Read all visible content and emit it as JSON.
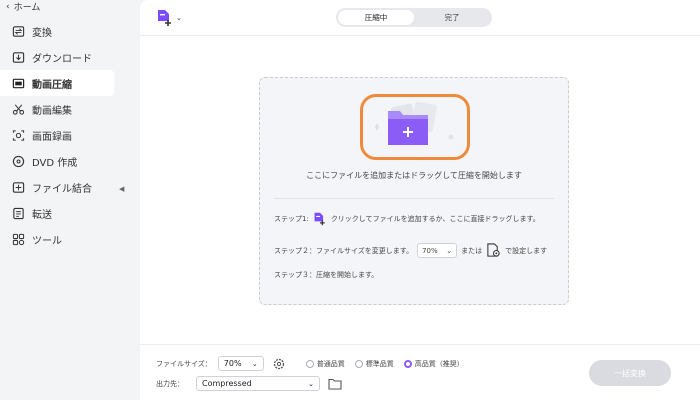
{
  "sidebar": {
    "back_label": "ホーム",
    "items": [
      {
        "label": "変換",
        "icon": "convert-icon"
      },
      {
        "label": "ダウンロード",
        "icon": "download-icon"
      },
      {
        "label": "動画圧縮",
        "icon": "compress-icon",
        "active": true
      },
      {
        "label": "動画編集",
        "icon": "scissors-icon"
      },
      {
        "label": "画面録画",
        "icon": "screen-record-icon"
      },
      {
        "label": "DVD 作成",
        "icon": "dvd-icon"
      },
      {
        "label": "ファイル結合",
        "icon": "merge-icon"
      },
      {
        "label": "転送",
        "icon": "transfer-icon"
      },
      {
        "label": "ツール",
        "icon": "tools-icon"
      }
    ]
  },
  "tabs": [
    {
      "label": "圧縮中",
      "active": true
    },
    {
      "label": "完了",
      "active": false
    }
  ],
  "dropzone": {
    "hint": "ここにファイルを追加またはドラッグして圧縮を開始します",
    "step1_prefix": "ステップ1:",
    "step1_text": "クリックしてファイルを追加するか、ここに直接ドラッグします。",
    "step2_prefix": "ステップ２：ファイルサイズを変更します。",
    "step2_value": "70%",
    "step2_or": "または",
    "step2_suffix": "で設定します",
    "step3": "ステップ３：圧縮を開始します。"
  },
  "bottom": {
    "filesize_label": "ファイルサイズ：",
    "filesize_value": "70%",
    "quality_options": [
      {
        "label": "普通品質",
        "selected": false
      },
      {
        "label": "標準品質",
        "selected": false
      },
      {
        "label": "高品質（推奨）",
        "selected": true
      }
    ],
    "output_label": "出力先：",
    "output_value": "Compressed",
    "convert_all": "一括変換"
  },
  "colors": {
    "accent": "#8b5cf6",
    "highlight_ring": "#f08a3b",
    "disabled_button": "#d9dbe0"
  }
}
